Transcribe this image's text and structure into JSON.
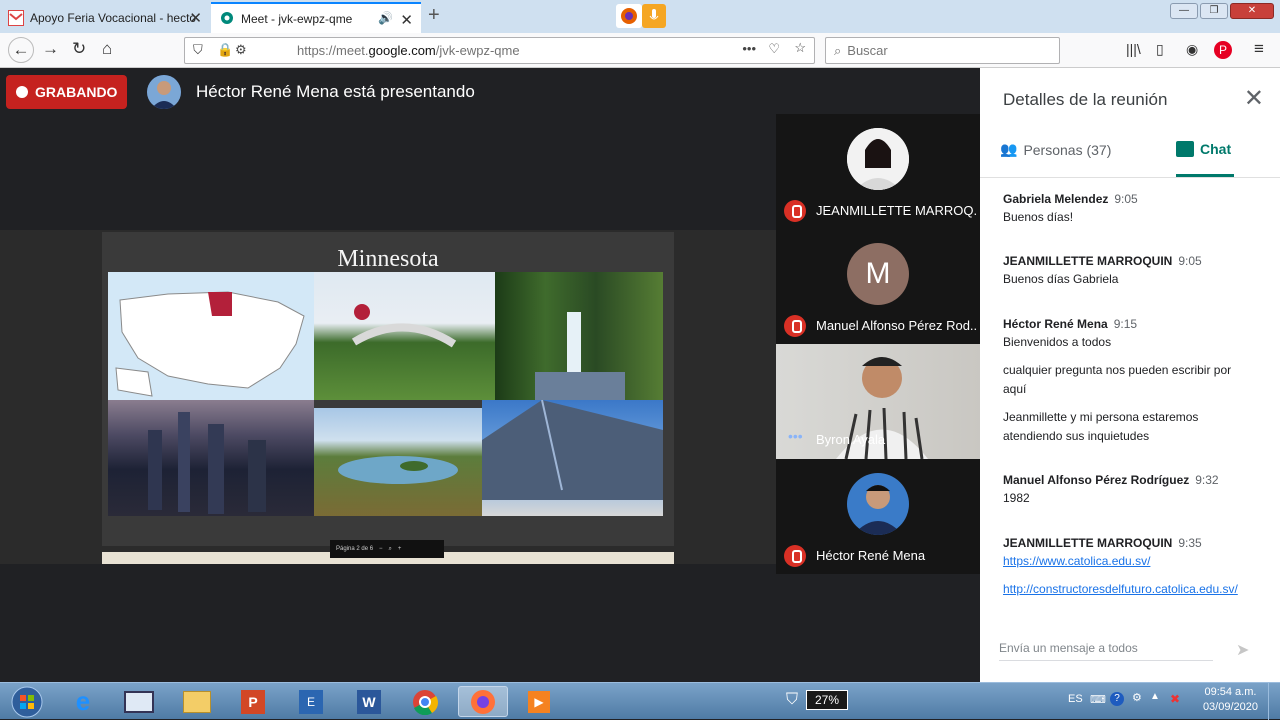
{
  "browser": {
    "tabs": [
      {
        "title": "Apoyo Feria Vocacional - hecto"
      },
      {
        "title": "Meet - jvk-ewpz-qme"
      }
    ],
    "url_prefix": "https://meet.",
    "url_domain": "google.com",
    "url_path": "/jvk-ewpz-qme",
    "search_placeholder": "Buscar"
  },
  "meet": {
    "recording_label": "GRABANDO",
    "presenting_text": "Héctor René Mena está presentando",
    "slide_title": "Minnesota",
    "slide_controls": "Página 2 de 6",
    "participants": [
      {
        "name": "JEANMILLETTE MARROQ...",
        "muted": true
      },
      {
        "name": "Manuel Alfonso Pérez Rod...",
        "initial": "M",
        "muted": true
      },
      {
        "name": "Byron Ayala",
        "muted": false
      },
      {
        "name": "Héctor René Mena",
        "muted": true
      }
    ]
  },
  "panel": {
    "title": "Detalles de la reunión",
    "people_tab": "Personas (37)",
    "chat_tab": "Chat",
    "messages": [
      {
        "sender": "Gabriela Melendez",
        "time": "9:05",
        "lines": [
          "Buenos días!"
        ]
      },
      {
        "sender": "JEANMILLETTE MARROQUIN",
        "time": "9:05",
        "lines": [
          "Buenos días Gabriela"
        ]
      },
      {
        "sender": "Héctor René Mena",
        "time": "9:15",
        "lines": [
          "Bienvenidos a todos",
          "cualquier pregunta nos pueden escribir por",
          "aquí",
          "Jeanmillette y mi persona estaremos",
          "atendiendo sus inquietudes"
        ]
      },
      {
        "sender": "Manuel Alfonso Pérez Rodríguez",
        "time": "9:32",
        "lines": [
          "1982"
        ]
      },
      {
        "sender": "JEANMILLETTE MARROQUIN",
        "time": "9:35",
        "links": [
          "https://www.catolica.edu.sv/",
          "http://constructoresdelfuturo.catolica.edu.sv/"
        ]
      }
    ],
    "compose_placeholder": "Envía un mensaje a todos"
  },
  "taskbar": {
    "battery": "27%",
    "lang": "ES",
    "time": "09:54 a.m.",
    "date": "03/09/2020"
  },
  "colors": {
    "recording": "#c5221f",
    "chat_accent": "#00796b",
    "link": "#1a73e8",
    "meet_bg": "#202124"
  }
}
